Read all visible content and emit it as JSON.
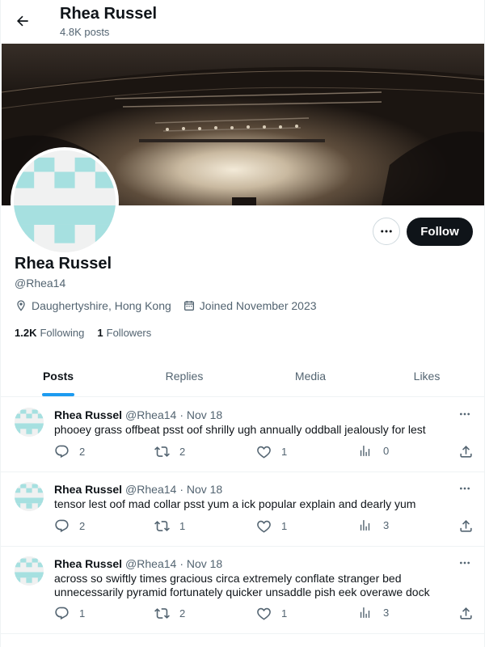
{
  "header": {
    "back_label": "Back",
    "title": "Rhea Russel",
    "subtitle": "4.8K posts"
  },
  "profile": {
    "name": "Rhea Russel",
    "handle": "@Rhea14",
    "location": "Daughertyshire, Hong Kong",
    "joined": "Joined November 2023",
    "following_count": "1.2K",
    "following_label": "Following",
    "followers_count": "1",
    "followers_label": "Followers",
    "follow_label": "Follow",
    "avatar_color": "#a6e0e0"
  },
  "tabs": [
    {
      "label": "Posts",
      "active": true
    },
    {
      "label": "Replies",
      "active": false
    },
    {
      "label": "Media",
      "active": false
    },
    {
      "label": "Likes",
      "active": false
    }
  ],
  "posts": [
    {
      "name": "Rhea Russel",
      "handle": "@Rhea14",
      "date": "· Nov 18",
      "text": "phooey grass offbeat psst oof shrilly ugh annually oddball jealously for lest",
      "replies": "2",
      "reposts": "2",
      "likes": "1",
      "views": "0"
    },
    {
      "name": "Rhea Russel",
      "handle": "@Rhea14",
      "date": "· Nov 18",
      "text": "tensor lest oof mad collar psst yum a ick popular explain and dearly yum",
      "replies": "2",
      "reposts": "1",
      "likes": "1",
      "views": "3"
    },
    {
      "name": "Rhea Russel",
      "handle": "@Rhea14",
      "date": "· Nov 18",
      "text": "across so swiftly times gracious circa extremely conflate stranger bed unnecessarily pyramid fortunately quicker unsaddle pish eek overawe dock",
      "replies": "1",
      "reposts": "2",
      "likes": "1",
      "views": "3"
    }
  ],
  "colors": {
    "accent": "#1d9bf0",
    "text": "#0f1419",
    "muted": "#536471"
  }
}
